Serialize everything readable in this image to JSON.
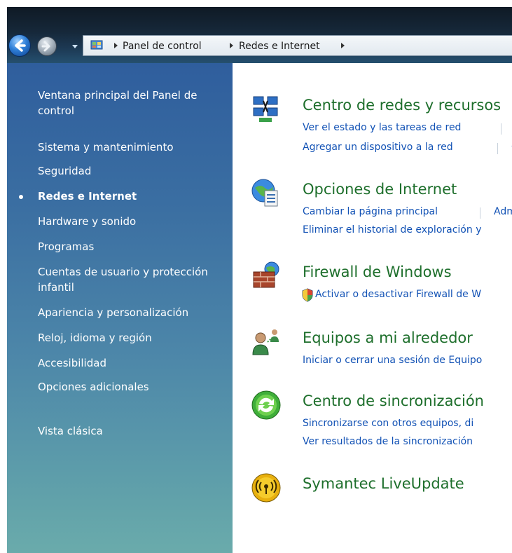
{
  "address_bar": {
    "crumbs": [
      "Panel de control",
      "Redes e Internet"
    ]
  },
  "sidebar": {
    "items": [
      {
        "label": "Ventana principal del Panel de control",
        "current": false
      },
      {
        "label": "Sistema y mantenimiento",
        "current": false
      },
      {
        "label": "Seguridad",
        "current": false
      },
      {
        "label": "Redes e Internet",
        "current": true
      },
      {
        "label": "Hardware y sonido",
        "current": false
      },
      {
        "label": "Programas",
        "current": false
      },
      {
        "label": "Cuentas de usuario y protección infantil",
        "current": false
      },
      {
        "label": "Apariencia y personalización",
        "current": false
      },
      {
        "label": "Reloj, idioma y región",
        "current": false
      },
      {
        "label": "Accesibilidad",
        "current": false
      },
      {
        "label": "Opciones adicionales",
        "current": false
      },
      {
        "label": "Vista clásica",
        "current": false
      }
    ]
  },
  "categories": [
    {
      "title": "Centro de redes y recursos",
      "icon": "network-center-icon",
      "tasks": [
        "Ver el estado y las tareas de red",
        "Agregar un dispositivo a la red"
      ],
      "tasks_second_col": [
        "",
        "C"
      ]
    },
    {
      "title": "Opciones de Internet",
      "icon": "internet-options-icon",
      "tasks": [
        "Cambiar la página principal",
        "Eliminar el historial de exploración y"
      ],
      "tasks_second_col": [
        "Adm",
        ""
      ]
    },
    {
      "title": "Firewall de Windows",
      "icon": "firewall-icon",
      "tasks": [
        "Activar o desactivar Firewall de W"
      ],
      "tasks_second_col": []
    },
    {
      "title": "Equipos a mi alrededor",
      "icon": "people-near-me-icon",
      "tasks": [
        "Iniciar o cerrar una sesión de Equipo"
      ],
      "tasks_second_col": []
    },
    {
      "title": "Centro de sincronización",
      "icon": "sync-center-icon",
      "tasks": [
        "Sincronizarse con otros equipos, di",
        "Ver resultados de la sincronización"
      ],
      "tasks_second_col": []
    },
    {
      "title": "Symantec LiveUpdate",
      "icon": "liveupdate-icon",
      "tasks": [],
      "tasks_second_col": []
    }
  ],
  "colors": {
    "category_title": "#1e6f2c",
    "task_link": "#1252b5",
    "sidebar_text": "#ffffff"
  }
}
